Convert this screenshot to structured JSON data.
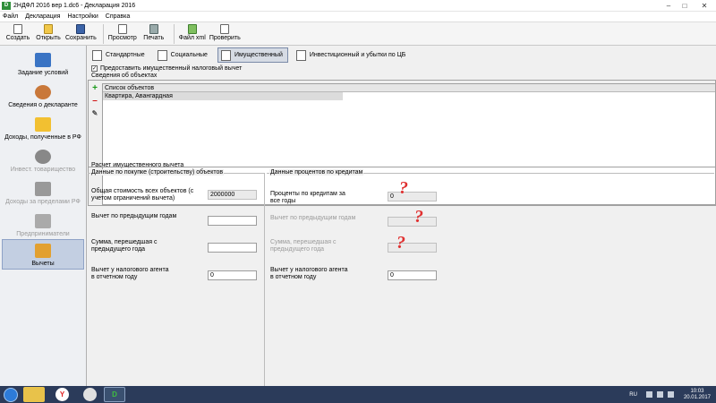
{
  "window": {
    "title": "2НДФЛ 2016 вер 1.dc6 - Декларация 2016"
  },
  "menu": [
    "Файл",
    "Декларация",
    "Настройки",
    "Справка"
  ],
  "toolbar": {
    "create": "Создать",
    "open": "Открыть",
    "save": "Сохранить",
    "preview": "Просмотр",
    "print": "Печать",
    "xml": "Файл xml",
    "check": "Проверить"
  },
  "sidebar": {
    "items": [
      {
        "label": "Задание условий",
        "icon": "conditions-icon",
        "state": "normal"
      },
      {
        "label": "Сведения о декларанте",
        "icon": "person-icon",
        "state": "normal"
      },
      {
        "label": "Доходы, полученные в РФ",
        "icon": "income-folder-icon",
        "state": "normal"
      },
      {
        "label": "Инвест. товарищество",
        "icon": "partnership-icon",
        "state": "disabled"
      },
      {
        "label": "Доходы за пределами РФ",
        "icon": "abroad-icon",
        "state": "disabled"
      },
      {
        "label": "Предприниматели",
        "icon": "entrepreneur-icon",
        "state": "disabled"
      },
      {
        "label": "Вычеты",
        "icon": "deductions-icon",
        "state": "active"
      }
    ]
  },
  "tabs": [
    {
      "label": "Стандартные",
      "active": false
    },
    {
      "label": "Социальные",
      "active": false
    },
    {
      "label": "Имущественный",
      "active": true
    },
    {
      "label": "Инвестиционный и убытки по ЦБ",
      "active": false
    }
  ],
  "property_checkbox": {
    "label": "Предоставить имущественный налоговый вычет",
    "checked": true,
    "mark": "✓"
  },
  "objects": {
    "section_label": "Сведения об объектах",
    "list_header": "Список объектов",
    "rows": [
      "Квартира, Авангардная"
    ]
  },
  "calc": {
    "section_label": "Расчет имущественного вычета",
    "purchase": {
      "group_label": "Данные по покупке (строительству) объектов",
      "total_cost_label": "Общая стоимость всех объектов (с учетом ограничений вычета)",
      "total_cost_value": "2000000",
      "prev_years_label": "Вычет по предыдущим годам",
      "prev_years_value": "",
      "carried_label": "Сумма, перешедшая с предыдущего года",
      "carried_value": "",
      "agent_label": "Вычет у налогового агента в отчетном году",
      "agent_value": "0"
    },
    "interest": {
      "group_label": "Данные процентов по кредитам",
      "all_years_label": "Проценты по кредитам за все годы",
      "all_years_value": "0",
      "prev_years_label": "Вычет по предыдущим годам",
      "prev_years_value": "",
      "carried_label": "Сумма, перешедшая с предыдущего года",
      "carried_value": "",
      "agent_label": "Вычет у налогового агента в отчетном году",
      "agent_value": "0"
    },
    "annotation_mark": "?"
  },
  "taskbar": {
    "lang": "RU",
    "time": "10:03",
    "date": "20.01.2017",
    "ndfl_label": "D"
  },
  "colors": {
    "annotation": "#e03030",
    "active_tab": "#d6dbe4",
    "taskbar": "#2b3b5a"
  }
}
